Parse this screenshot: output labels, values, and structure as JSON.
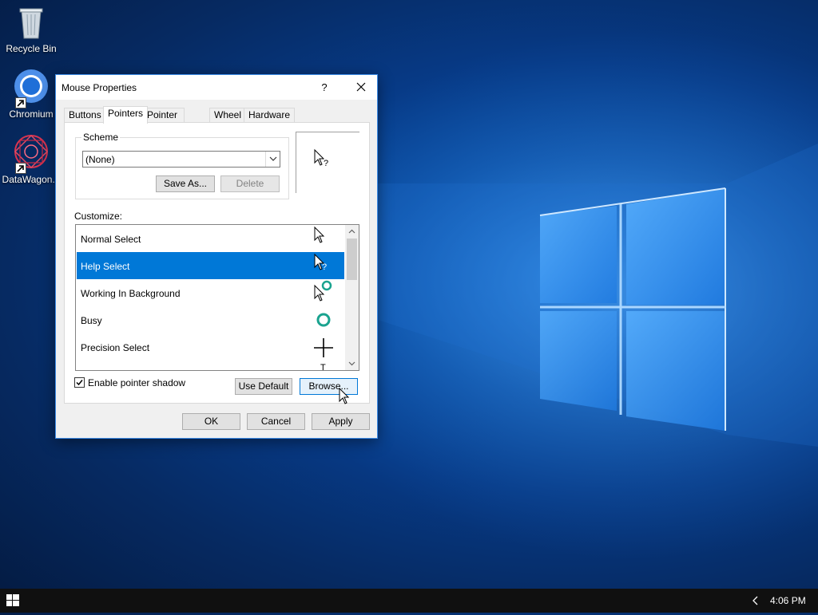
{
  "desktop": {
    "icons": [
      {
        "label": "Recycle Bin",
        "icon": "recycle-bin-icon"
      },
      {
        "label": "Chromium",
        "icon": "chromium-icon"
      },
      {
        "label": "DataWagon...",
        "icon": "datawagon-icon"
      }
    ]
  },
  "dialog": {
    "title": "Mouse Properties",
    "help_glyph": "?",
    "tabs": [
      {
        "label": "Buttons"
      },
      {
        "label": "Pointers",
        "active": true
      },
      {
        "label": "Pointer Options"
      },
      {
        "label": "Wheel"
      },
      {
        "label": "Hardware"
      }
    ],
    "scheme": {
      "legend": "Scheme",
      "value": "(None)",
      "save_as_label": "Save As...",
      "delete_label": "Delete"
    },
    "customize_label": "Customize:",
    "pointers": [
      {
        "label": "Normal Select",
        "cursor": "arrow-cursor-icon"
      },
      {
        "label": "Help Select",
        "cursor": "help-cursor-icon",
        "selected": true
      },
      {
        "label": "Working In Background",
        "cursor": "working-cursor-icon"
      },
      {
        "label": "Busy",
        "cursor": "busy-cursor-icon"
      },
      {
        "label": "Precision Select",
        "cursor": "crosshair-cursor-icon"
      }
    ],
    "partial_next_glyph": "T",
    "enable_shadow_label": "Enable pointer shadow",
    "enable_shadow_checked": true,
    "use_default_label": "Use Default",
    "browse_label": "Browse...",
    "ok_label": "OK",
    "cancel_label": "Cancel",
    "apply_label": "Apply",
    "accent_color": "#0078d7"
  },
  "taskbar": {
    "clock": "4:06 PM"
  }
}
